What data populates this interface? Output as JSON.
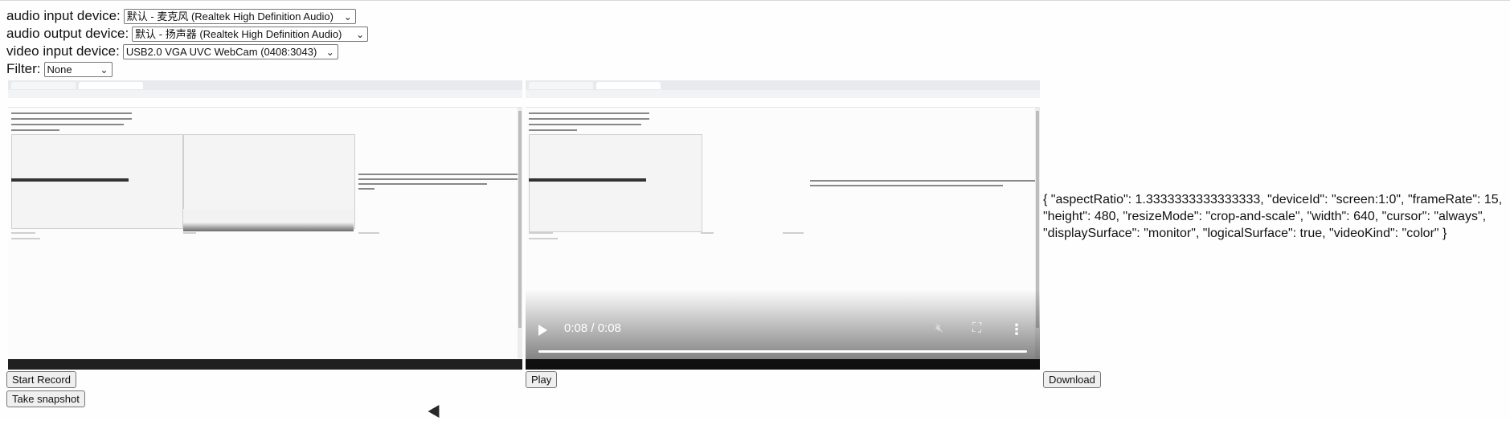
{
  "audio_input": {
    "label": "audio input device:",
    "selected": "默认 - 麦克风 (Realtek High Definition Audio)"
  },
  "audio_output": {
    "label": "audio output device:",
    "selected": "默认 - 扬声器 (Realtek High Definition Audio)"
  },
  "video_input": {
    "label": "video input device:",
    "selected": "USB2.0 VGA UVC WebCam (0408:3043)"
  },
  "filter": {
    "label": "Filter:",
    "selected": "None"
  },
  "recorded_video": {
    "time": "0:08 / 0:08",
    "play_icon": "play-icon",
    "volume_icon": "volume-icon",
    "fullscreen_icon": "fullscreen-icon",
    "more_icon": "more-vert-icon"
  },
  "buttons": {
    "start_record": "Start Record",
    "take_snapshot": "Take snapshot",
    "play": "Play",
    "download": "Download"
  },
  "settings_json": "{ \"aspectRatio\": 1.3333333333333333, \"deviceId\": \"screen:1:0\", \"frameRate\": 15, \"height\": 480, \"resizeMode\": \"crop-and-scale\", \"width\": 640, \"cursor\": \"always\", \"displaySurface\": \"monitor\", \"logicalSurface\": true, \"videoKind\": \"color\" }"
}
